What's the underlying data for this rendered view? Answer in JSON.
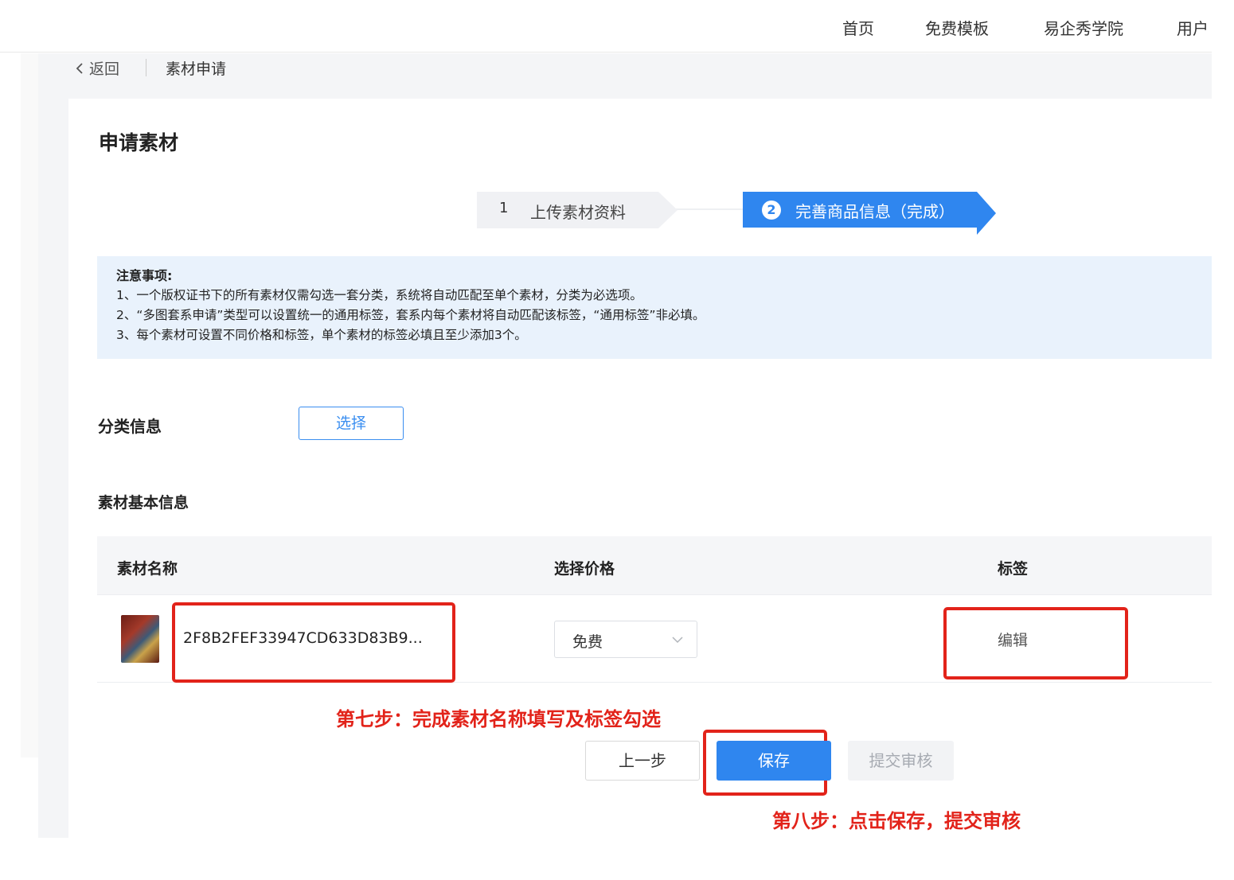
{
  "nav": {
    "items": [
      "首页",
      "免费模板",
      "易企秀学院",
      "用户"
    ]
  },
  "breadcrumb": {
    "back_label": "返回",
    "current": "素材申请"
  },
  "page": {
    "title": "申请素材"
  },
  "steps": [
    {
      "num": "1",
      "label": "上传素材资料",
      "active": false
    },
    {
      "num": "2",
      "label": "完善商品信息（完成）",
      "active": true
    }
  ],
  "notice": {
    "title": "注意事项:",
    "lines": [
      "1、一个版权证书下的所有素材仅需勾选一套分类，系统将自动匹配至单个素材，分类为必选项。",
      "2、“多图套系申请”类型可以设置统一的通用标签，套系内每个素材将自动匹配该标签，“通用标签”非必填。",
      "3、每个素材可设置不同价格和标签，单个素材的标签必填且至少添加3个。"
    ]
  },
  "category": {
    "label": "分类信息",
    "select_button": "选择"
  },
  "basic_info": {
    "label": "素材基本信息",
    "columns": [
      "素材名称",
      "选择价格",
      "标签"
    ],
    "rows": [
      {
        "name": "2F8B2FEF33947CD633D83B9...",
        "price": "免费",
        "tag_action": "编辑"
      }
    ]
  },
  "actions": {
    "prev": "上一步",
    "save": "保存",
    "submit": "提交审核"
  },
  "annotations": {
    "step7": "第七步：完成素材名称填写及标签勾选",
    "step8": "第八步：点击保存，提交审核"
  },
  "colors": {
    "accent": "#2f86ef",
    "annotation": "#e2231a",
    "notice_bg": "#e9f2fc"
  }
}
